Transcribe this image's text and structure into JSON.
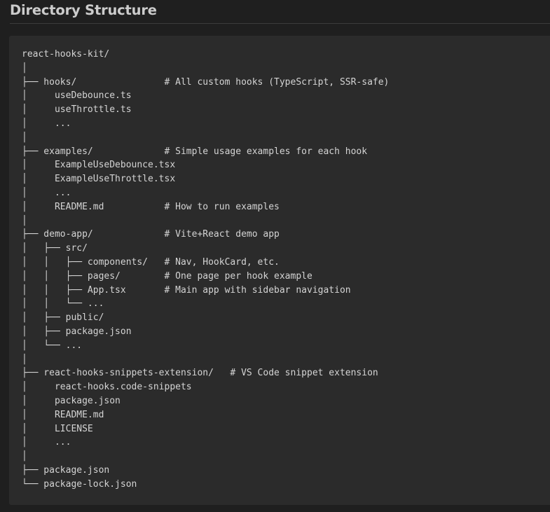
{
  "heading": "Directory Structure",
  "tree_lines": [
    "react-hooks-kit/",
    "│",
    "├── hooks/                # All custom hooks (TypeScript, SSR-safe)",
    "│     useDebounce.ts",
    "│     useThrottle.ts",
    "│     ...",
    "│",
    "├── examples/             # Simple usage examples for each hook",
    "│     ExampleUseDebounce.tsx",
    "│     ExampleUseThrottle.tsx",
    "│     ...",
    "│     README.md           # How to run examples",
    "│",
    "├── demo-app/             # Vite+React demo app",
    "│   ├── src/",
    "│   │   ├── components/   # Nav, HookCard, etc.",
    "│   │   ├── pages/        # One page per hook example",
    "│   │   ├── App.tsx       # Main app with sidebar navigation",
    "│   │   └── ...",
    "│   ├── public/",
    "│   ├── package.json",
    "│   └── ...",
    "│",
    "├── react-hooks-snippets-extension/   # VS Code snippet extension",
    "│     react-hooks.code-snippets",
    "│     package.json",
    "│     README.md",
    "│     LICENSE",
    "│     ...",
    "│",
    "├── package.json",
    "└── package-lock.json"
  ]
}
